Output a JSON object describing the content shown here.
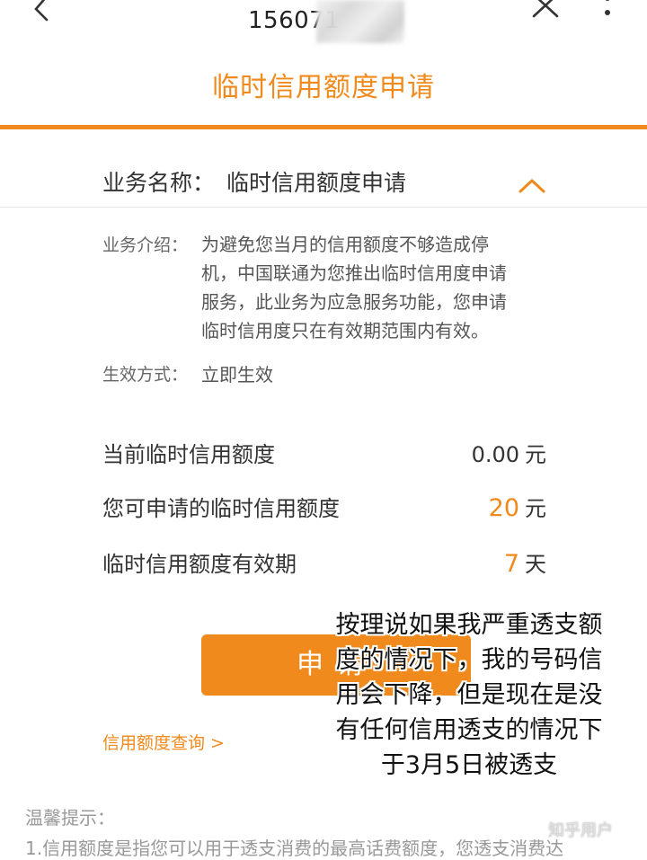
{
  "header": {
    "phone_number": "156071",
    "title": "临时信用额度申请"
  },
  "service": {
    "name_label": "业务名称：",
    "name_value": "临时信用额度申请",
    "intro_label": "业务介绍：",
    "intro_lines": [
      "为避免您当月的信用额度不够造成停",
      "机，中国联通为您推出临时信用度申请",
      "服务，此业务为应急服务功能，您申请",
      "临时信用度只在有效期范围内有效。"
    ],
    "effect_label": "生效方式：",
    "effect_value": "立即生效"
  },
  "rows": [
    {
      "label": "当前临时信用额度",
      "value": "0.00",
      "unit": "元"
    },
    {
      "label": "您可申请的临时信用额度",
      "value": "20",
      "unit": "元"
    },
    {
      "label": "临时信用额度有效期",
      "value": "7",
      "unit": "天"
    }
  ],
  "actions": {
    "apply_label": "申请",
    "credit_query_link": "信用额度查询 >"
  },
  "overlay_note": [
    "按理说如果我严重透支额",
    "度的情况下，我的号码信",
    "用会下降，但是现在是没",
    "有任何信用透支的情况下",
    "于3月5日被透支"
  ],
  "tips": {
    "title": "温馨提示：",
    "line1": "1.信用额度是指您可以用于透支消费的最高话费额度，您透支消费达"
  },
  "watermark": "知乎用户",
  "colors": {
    "accent": "#f08a1c",
    "text": "#333333",
    "muted": "#999999"
  }
}
